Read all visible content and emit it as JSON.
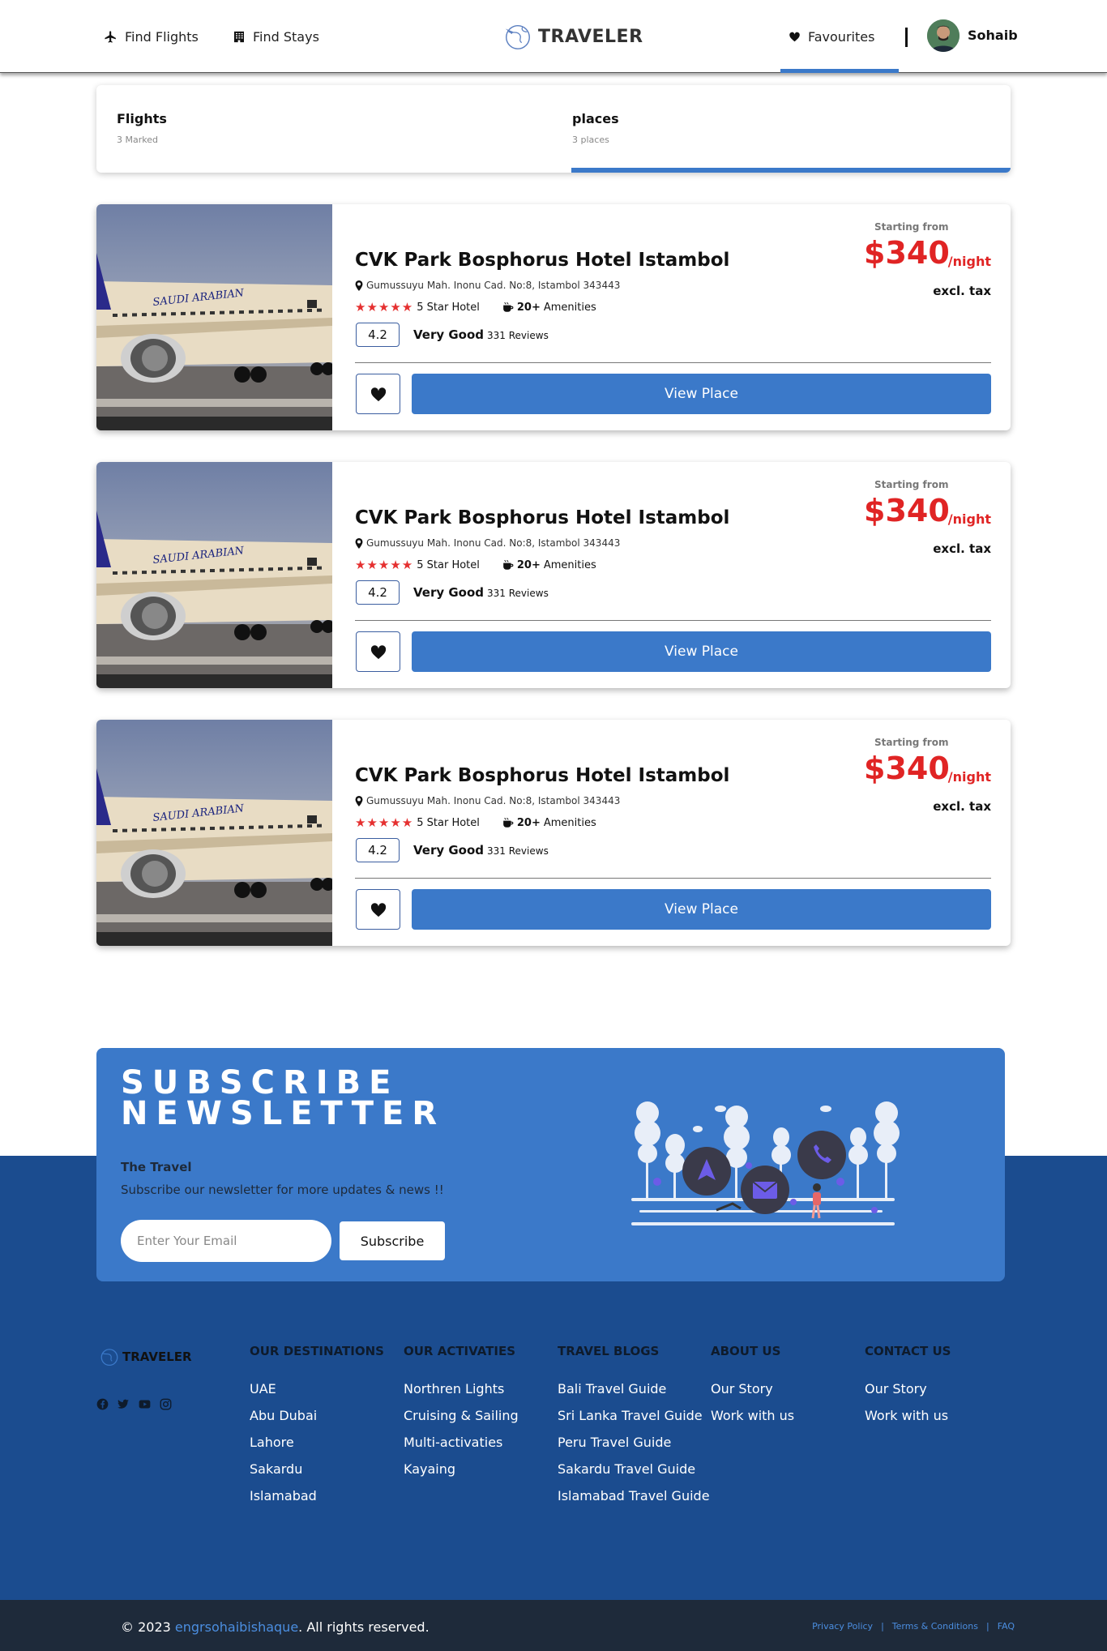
{
  "nav": {
    "find_flights": "Find Flights",
    "find_stays": "Find Stays",
    "brand": "TRAVELER",
    "favourites": "Favourites",
    "user_name": "Sohaib"
  },
  "tabs": [
    {
      "title": "Flights",
      "sub": "3 Marked"
    },
    {
      "title": "places",
      "sub": "3 places"
    }
  ],
  "cards": [
    {
      "name": "CVK Park Bosphorus Hotel Istambol",
      "address": "Gumussuyu Mah. Inonu Cad. No:8, Istambol 343443",
      "stars": "★★★★★",
      "hotel_class": "5 Star Hotel",
      "amenities_count": "20+",
      "amenities_label": "Amenities",
      "rating": "4.2",
      "rating_label": "Very Good",
      "reviews": "331 Reviews",
      "starting": "Starting from",
      "price": "$340",
      "per": "/night",
      "tax": "excl. tax",
      "button": "View Place"
    },
    {
      "name": "CVK Park Bosphorus Hotel Istambol",
      "address": "Gumussuyu Mah. Inonu Cad. No:8, Istambol 343443",
      "stars": "★★★★★",
      "hotel_class": "5 Star Hotel",
      "amenities_count": "20+",
      "amenities_label": "Amenities",
      "rating": "4.2",
      "rating_label": "Very Good",
      "reviews": "331 Reviews",
      "starting": "Starting from",
      "price": "$340",
      "per": "/night",
      "tax": "excl. tax",
      "button": "View Place"
    },
    {
      "name": "CVK Park Bosphorus Hotel Istambol",
      "address": "Gumussuyu Mah. Inonu Cad. No:8, Istambol 343443",
      "stars": "★★★★★",
      "hotel_class": "5 Star Hotel",
      "amenities_count": "20+",
      "amenities_label": "Amenities",
      "rating": "4.2",
      "rating_label": "Very Good",
      "reviews": "331 Reviews",
      "starting": "Starting from",
      "price": "$340",
      "per": "/night",
      "tax": "excl. tax",
      "button": "View Place"
    }
  ],
  "newsletter": {
    "title_line1": "SUBSCRIBE",
    "title_line2": "NEWSLETTER",
    "subtitle": "The Travel",
    "description": "Subscribe our newsletter for more updates & news !!",
    "email_placeholder": "Enter Your Email",
    "button": "Subscribe"
  },
  "footer": {
    "brand": "TRAVELER",
    "social_icons": [
      "facebook-icon",
      "twitter-icon",
      "youtube-icon",
      "instagram-icon"
    ],
    "columns": [
      {
        "heading": "OUR DESTINATIONS",
        "links": [
          "UAE",
          "Abu Dubai",
          "Lahore",
          "Sakardu",
          "Islamabad"
        ]
      },
      {
        "heading": "OUR ACTIVATIES",
        "links": [
          "Northren Lights",
          "Cruising & Sailing",
          "Multi-activaties",
          "Kayaing"
        ]
      },
      {
        "heading": "TRAVEL BLOGS",
        "links": [
          "Bali Travel Guide",
          "Sri Lanka Travel Guide",
          "Peru Travel Guide",
          "Sakardu Travel Guide",
          "Islamabad Travel Guide"
        ]
      },
      {
        "heading": "ABOUT US",
        "links": [
          "Our Story",
          "Work with us"
        ]
      },
      {
        "heading": "CONTACT US",
        "links": [
          "Our Story",
          "Work with us"
        ]
      }
    ],
    "copyright_prefix": "© 2023",
    "copyright_author": "engrsohaibishaque",
    "copyright_suffix": ". All rights reserved.",
    "legal": [
      "Privacy Policy",
      "Terms & Conditions",
      "FAQ"
    ]
  },
  "colors": {
    "accent": "#3b79c9",
    "price": "#e02424",
    "footer_bg": "#1b4c8f",
    "bottom_bar": "#1e2a3a"
  }
}
